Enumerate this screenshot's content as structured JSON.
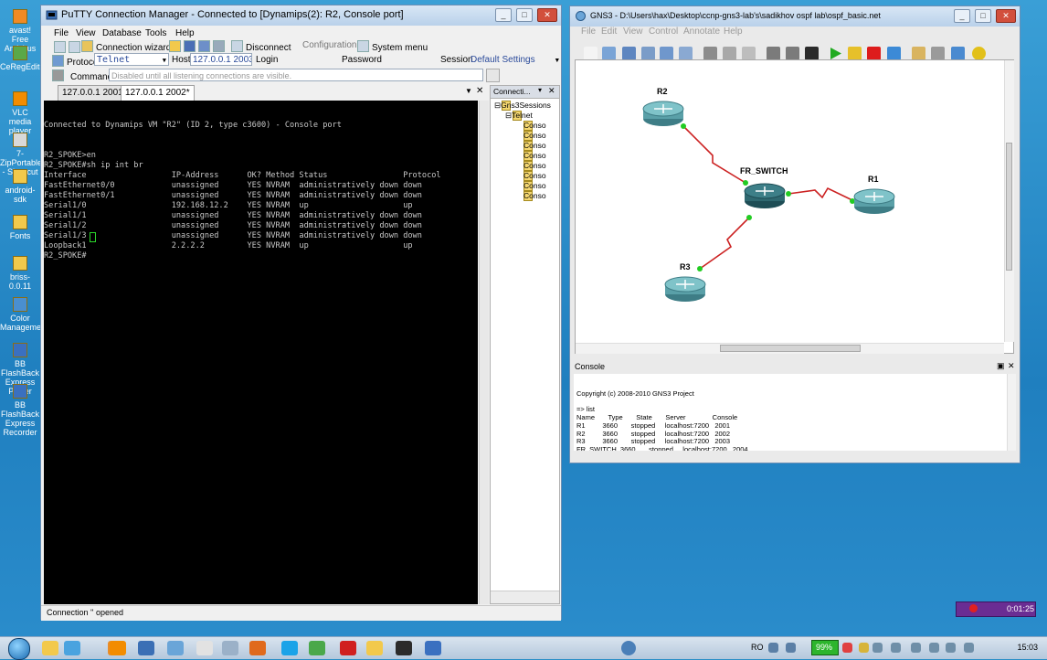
{
  "desktop": {
    "icons": [
      {
        "label": "avast! Free Antivirus",
        "color": "#f08a24"
      },
      {
        "label": "CeRegEditor",
        "color": "#5aa848"
      },
      {
        "label": "VLC media player",
        "color": "#f28c00"
      },
      {
        "label": "7-ZipPortable - Shortcut",
        "color": "#d9d9d9"
      },
      {
        "label": "android-sdk",
        "color": "#f2c94c"
      },
      {
        "label": "Fonts",
        "color": "#f2c94c"
      },
      {
        "label": "briss-0.0.11",
        "color": "#f2c94c"
      },
      {
        "label": "Color Management",
        "color": "#4a8fd0"
      },
      {
        "label": "BB FlashBack Express Player",
        "color": "#3a70c0"
      },
      {
        "label": "BB FlashBack Express Recorder",
        "color": "#3a70c0"
      }
    ]
  },
  "putty": {
    "title": "PuTTY Connection Manager - Connected to [Dynamips(2): R2, Console port]",
    "menu": [
      "File",
      "View",
      "Database",
      "Tools",
      "Help"
    ],
    "toolbar": {
      "connection_wizard": "Connection wizard...",
      "disconnect": "Disconnect",
      "configuration": "Configuration",
      "system_menu": "System menu"
    },
    "row2": {
      "protocol_label": "Protocol",
      "protocol_value": "Telnet",
      "host_label": "Host",
      "host_value": "127.0.0.1 2003",
      "login_label": "Login",
      "password_label": "Password",
      "session_label": "Session",
      "session_value": "Default Settings"
    },
    "row3": {
      "command_label": "Command",
      "command_placeholder": "Disabled until all listening connections are visible."
    },
    "tabs": [
      "127.0.0.1 2001*",
      "127.0.0.1 2002*"
    ],
    "terminal_lines": [
      "Connected to Dynamips VM \"R2\" (ID 2, type c3600) - Console port",
      "",
      "",
      "R2_SPOKE>en",
      "R2_SPOKE#sh ip int br",
      "Interface                  IP-Address      OK? Method Status                Protocol",
      "FastEthernet0/0            unassigned      YES NVRAM  administratively down down",
      "FastEthernet0/1            unassigned      YES NVRAM  administratively down down",
      "Serial1/0                  192.168.12.2    YES NVRAM  up                    up",
      "Serial1/1                  unassigned      YES NVRAM  administratively down down",
      "Serial1/2                  unassigned      YES NVRAM  administratively down down",
      "Serial1/3                  unassigned      YES NVRAM  administratively down down",
      "Loopback1                  2.2.2.2         YES NVRAM  up                    up",
      "R2_SPOKE#"
    ],
    "panel_title": "Connecti...",
    "tree": {
      "root": "Gns3Sessions",
      "folder": "Telnet",
      "items": [
        "Conso",
        "Conso",
        "Conso",
        "Conso",
        "Conso",
        "Conso",
        "Conso",
        "Conso"
      ]
    },
    "status": "Connection '' opened"
  },
  "gns3": {
    "title": "GNS3 - D:\\Users\\hax\\Desktop\\ccnp-gns3-lab's\\sadikhov ospf lab\\ospf_basic.net",
    "menu": [
      "File",
      "Edit",
      "View",
      "Control",
      "Annotate",
      "Help"
    ],
    "nodes": {
      "r2": "R2",
      "fr_switch": "FR_SWITCH",
      "r1": "R1",
      "r3": "R3"
    },
    "console_title": "Console",
    "console_lines": [
      "Copyright (c) 2008-2010 GNS3 Project",
      "",
      "=> list",
      "Name       Type       State       Server              Console",
      "R1         3660       stopped     localhost:7200   2001",
      "R2         3660       stopped     localhost:7200   2002",
      "R3         3660       stopped     localhost:7200   2003",
      "FR_SWITCH  3660       stopped     localhost:7200   2004",
      "=>"
    ]
  },
  "taskbar": {
    "battery": "99%",
    "lang": "RO",
    "clock": "15:03",
    "recorder_time": "0:01:25"
  }
}
